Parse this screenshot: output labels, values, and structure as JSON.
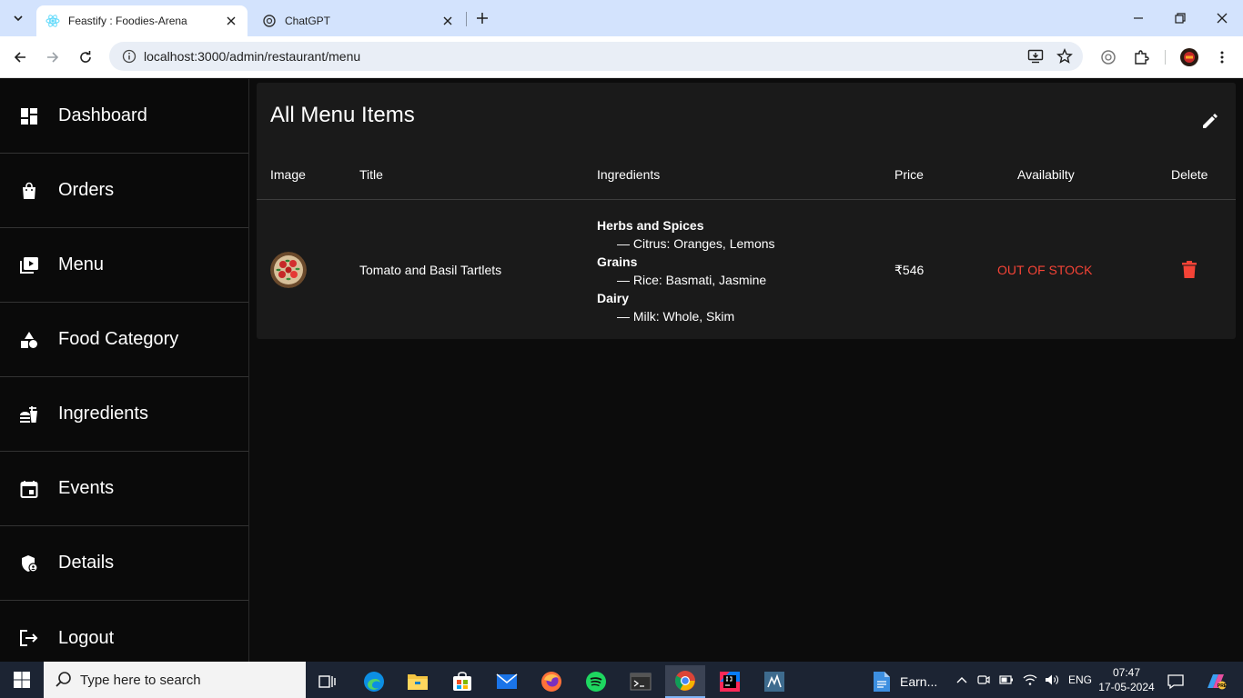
{
  "browser": {
    "tabs": [
      {
        "title": "Feastify : Foodies-Arena",
        "active": true
      },
      {
        "title": "ChatGPT",
        "active": false
      }
    ],
    "url": "localhost:3000/admin/restaurant/menu"
  },
  "sidebar": {
    "items": [
      {
        "label": "Dashboard",
        "icon": "dashboard-icon"
      },
      {
        "label": "Orders",
        "icon": "shopping-bag-icon"
      },
      {
        "label": "Menu",
        "icon": "menu-book-icon"
      },
      {
        "label": "Food Category",
        "icon": "category-icon"
      },
      {
        "label": "Ingredients",
        "icon": "fastfood-icon"
      },
      {
        "label": "Events",
        "icon": "event-icon"
      },
      {
        "label": "Details",
        "icon": "admin-panel-icon"
      },
      {
        "label": "Logout",
        "icon": "logout-icon"
      }
    ]
  },
  "main": {
    "title": "All Menu Items",
    "columns": {
      "image": "Image",
      "title": "Title",
      "ingredients": "Ingredients",
      "price": "Price",
      "availability": "Availabilty",
      "delete": "Delete"
    },
    "rows": [
      {
        "title": "Tomato and Basil Tartlets",
        "ingredients": [
          {
            "category": "Herbs and Spices",
            "item": "— Citrus: Oranges, Lemons"
          },
          {
            "category": "Grains",
            "item": "— Rice: Basmati, Jasmine"
          },
          {
            "category": "Dairy",
            "item": "— Milk: Whole, Skim"
          }
        ],
        "price": "₹546",
        "availability": "OUT OF STOCK"
      }
    ]
  },
  "taskbar": {
    "search_placeholder": "Type here to search",
    "pinned_label": "Earn...",
    "language": "ENG",
    "time": "07:47",
    "date": "17-05-2024"
  },
  "colors": {
    "accent_red": "#f44336",
    "panel_bg": "#1a1a1a",
    "page_bg": "#0c0c0c"
  }
}
